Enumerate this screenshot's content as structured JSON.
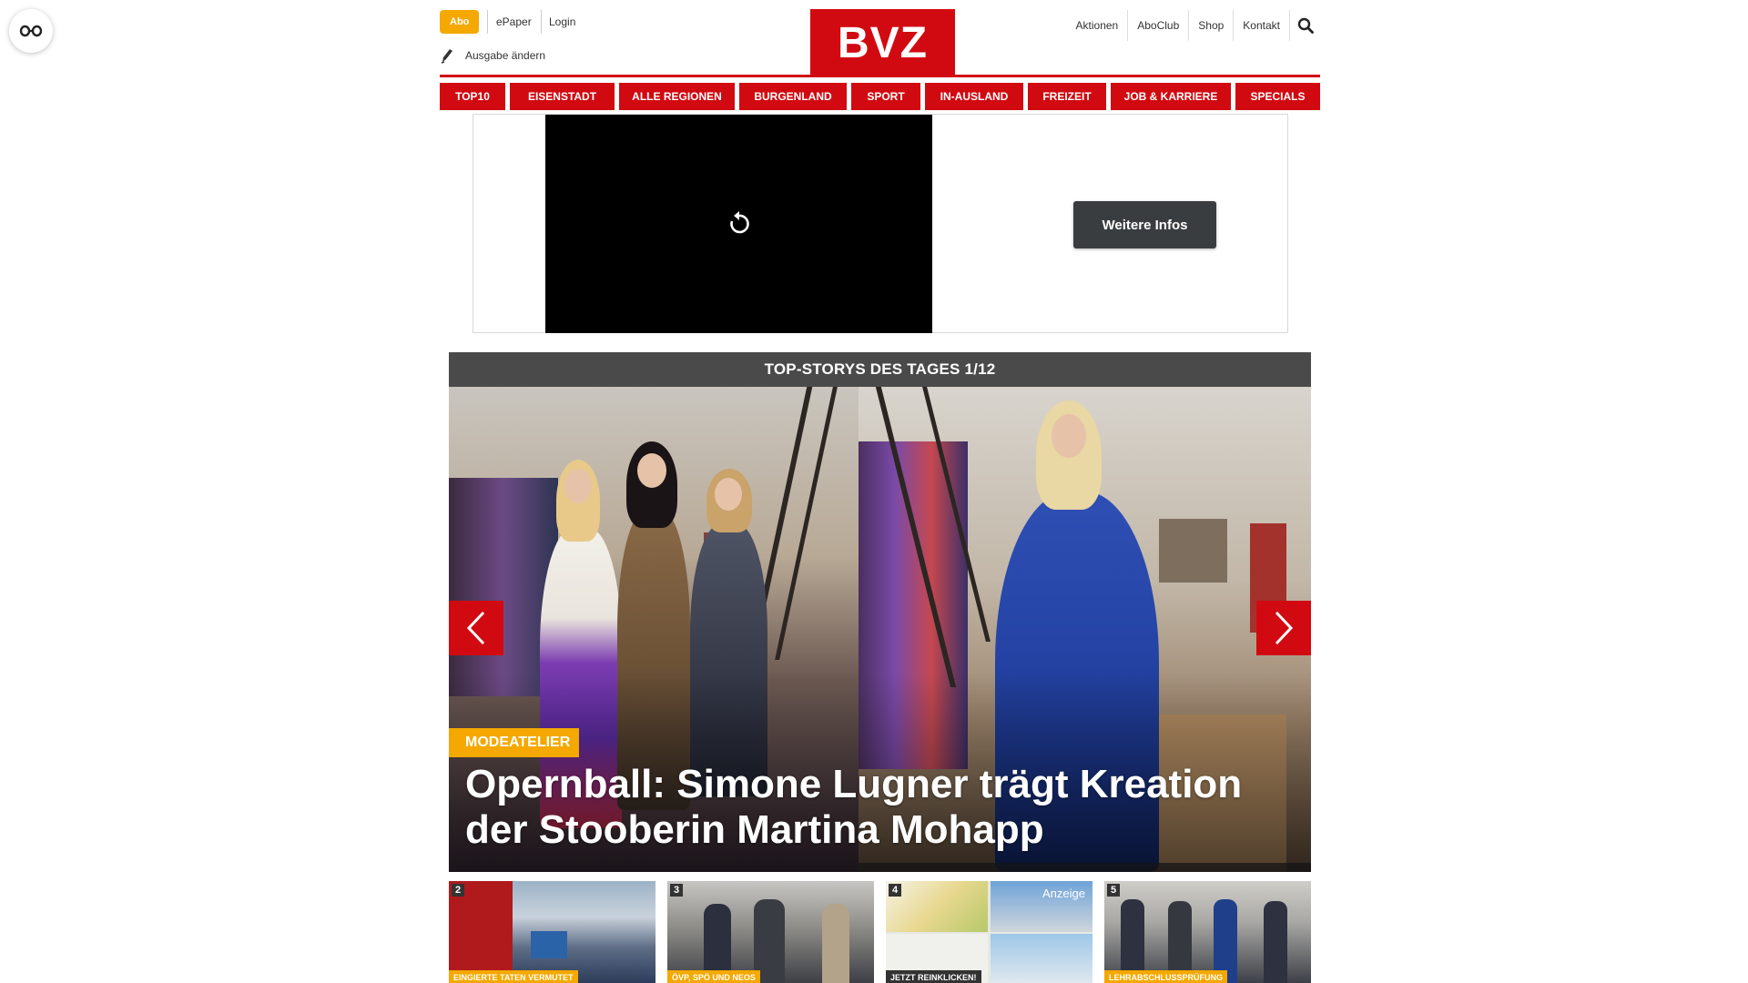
{
  "top_bar": {
    "abo": "Abo",
    "epaper": "ePaper",
    "login": "Login",
    "ausgabe": "Ausgabe ändern"
  },
  "logo": "BVZ",
  "right_links": [
    "Aktionen",
    "AboClub",
    "Shop",
    "Kontakt"
  ],
  "nav": [
    {
      "label": "TOP10"
    },
    {
      "label": "EISENSTADT"
    },
    {
      "label": "ALLE REGIONEN"
    },
    {
      "label": "BURGENLAND"
    },
    {
      "label": "SPORT"
    },
    {
      "label": "IN-AUSLAND"
    },
    {
      "label": "FREIZEIT"
    },
    {
      "label": "JOB & KARRIERE"
    },
    {
      "label": "SPECIALS"
    }
  ],
  "ad": {
    "more_button": "Weitere Infos"
  },
  "stories": {
    "header": "TOP-STORYS DES TAGES 1/12",
    "kicker": "MODEATELIER",
    "headline": "Opernball: Simone Lugner trägt Kreation der Stooberin Martina Mohapp"
  },
  "thumbs": [
    {
      "num": "2",
      "tag": "EINGIERTE TATEN VERMUTET"
    },
    {
      "num": "3",
      "tag": "ÖVP, SPÖ UND NEOS"
    },
    {
      "num": "4",
      "tag": "JETZT REINKLICKEN!",
      "ad_label": "Anzeige"
    },
    {
      "num": "5",
      "tag": "LEHRABSCHLUSSPRÜFUNG"
    }
  ],
  "colors": {
    "brand_red": "#d10a11",
    "accent_orange": "#f4a800",
    "dark_bar": "#4a4a4a"
  }
}
